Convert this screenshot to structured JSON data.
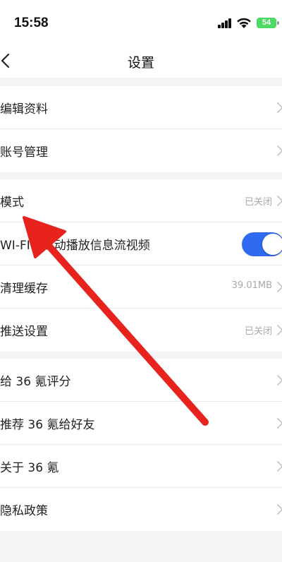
{
  "status_bar": {
    "time": "15:58",
    "battery": "54"
  },
  "nav": {
    "title": "设置"
  },
  "group1": [
    {
      "label": "编辑资料"
    },
    {
      "label": "账号管理"
    }
  ],
  "group2": {
    "mode": {
      "label": "模式",
      "value": "已关闭"
    },
    "wifi_autoplay": {
      "label": "WI-FI下自动播放信息流视频",
      "enabled": true
    },
    "clear_cache": {
      "label": "清理缓存",
      "value": "39.01MB"
    },
    "push": {
      "label": "推送设置",
      "value": "已关闭"
    }
  },
  "group3": [
    {
      "label": "给 36 氪评分"
    },
    {
      "label": "推荐 36 氪给好友"
    },
    {
      "label": "关于 36 氪"
    },
    {
      "label": "隐私政策"
    }
  ],
  "colors": {
    "toggle_on": "#2f6bf0",
    "annotation_arrow": "#e8231e",
    "battery": "#4cd964"
  }
}
